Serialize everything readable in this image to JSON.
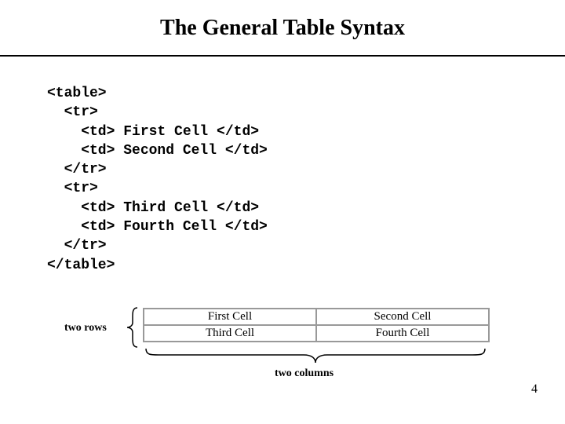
{
  "title": "The General Table Syntax",
  "code": {
    "l0": "<table>",
    "l1": "  <tr>",
    "l2": "    <td> First Cell </td>",
    "l3": "    <td> Second Cell </td>",
    "l4": "  </tr>",
    "l5": "  <tr>",
    "l6": "    <td> Third Cell </td>",
    "l7": "    <td> Fourth Cell </td>",
    "l8": "  </tr>",
    "l9": "</table>"
  },
  "diagram": {
    "rows_label": "two rows",
    "cols_label": "two columns",
    "cells": {
      "r0c0": "First Cell",
      "r0c1": "Second Cell",
      "r1c0": "Third Cell",
      "r1c1": "Fourth Cell"
    }
  },
  "page_number": "4"
}
